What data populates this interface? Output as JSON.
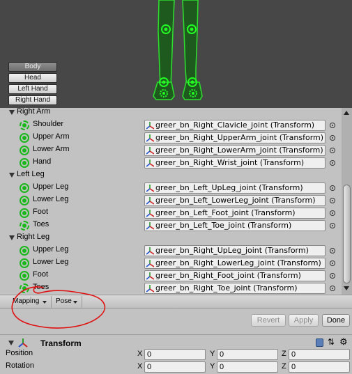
{
  "preview": {
    "tabs": [
      {
        "label": "Body"
      },
      {
        "label": "Head"
      },
      {
        "label": "Left Hand"
      },
      {
        "label": "Right Hand"
      }
    ]
  },
  "groups": [
    {
      "label": "Right Arm",
      "bones": [
        {
          "label": "Shoulder",
          "value": "greer_bn_Right_Clavicle_joint (Transform)",
          "optional": true
        },
        {
          "label": "Upper Arm",
          "value": "greer_bn_Right_UpperArm_joint (Transform)",
          "optional": false
        },
        {
          "label": "Lower Arm",
          "value": "greer_bn_Right_LowerArm_joint (Transform)",
          "optional": false
        },
        {
          "label": "Hand",
          "value": "greer_bn_Right_Wrist_joint (Transform)",
          "optional": false
        }
      ]
    },
    {
      "label": "Left Leg",
      "bones": [
        {
          "label": "Upper Leg",
          "value": "greer_bn_Left_UpLeg_joint (Transform)",
          "optional": false
        },
        {
          "label": "Lower Leg",
          "value": "greer_bn_Left_LowerLeg_joint (Transform)",
          "optional": false
        },
        {
          "label": "Foot",
          "value": "greer_bn_Left_Foot_joint (Transform)",
          "optional": false
        },
        {
          "label": "Toes",
          "value": "greer_bn_Left_Toe_joint (Transform)",
          "optional": true
        }
      ]
    },
    {
      "label": "Right Leg",
      "bones": [
        {
          "label": "Upper Leg",
          "value": "greer_bn_Right_UpLeg_joint (Transform)",
          "optional": false
        },
        {
          "label": "Lower Leg",
          "value": "greer_bn_Right_LowerLeg_joint (Transform)",
          "optional": false
        },
        {
          "label": "Foot",
          "value": "greer_bn_Right_Foot_joint (Transform)",
          "optional": false
        },
        {
          "label": "Toes",
          "value": "greer_bn_Right_Toe_joint (Transform)",
          "optional": true
        }
      ]
    }
  ],
  "toolbar": {
    "mapping_label": "Mapping",
    "pose_label": "Pose"
  },
  "actions": {
    "revert_label": "Revert",
    "apply_label": "Apply",
    "done_label": "Done"
  },
  "transform": {
    "title": "Transform",
    "position_label": "Position",
    "rotation_label": "Rotation",
    "axis_x": "X",
    "axis_y": "Y",
    "axis_z": "Z",
    "position": {
      "x": "0",
      "y": "0",
      "z": "0"
    },
    "rotation": {
      "x": "0",
      "y": "0",
      "z": "0"
    }
  },
  "colors": {
    "bone_mapped": "#18b818",
    "preview_bg": "#474747",
    "annotation": "#e01010"
  }
}
